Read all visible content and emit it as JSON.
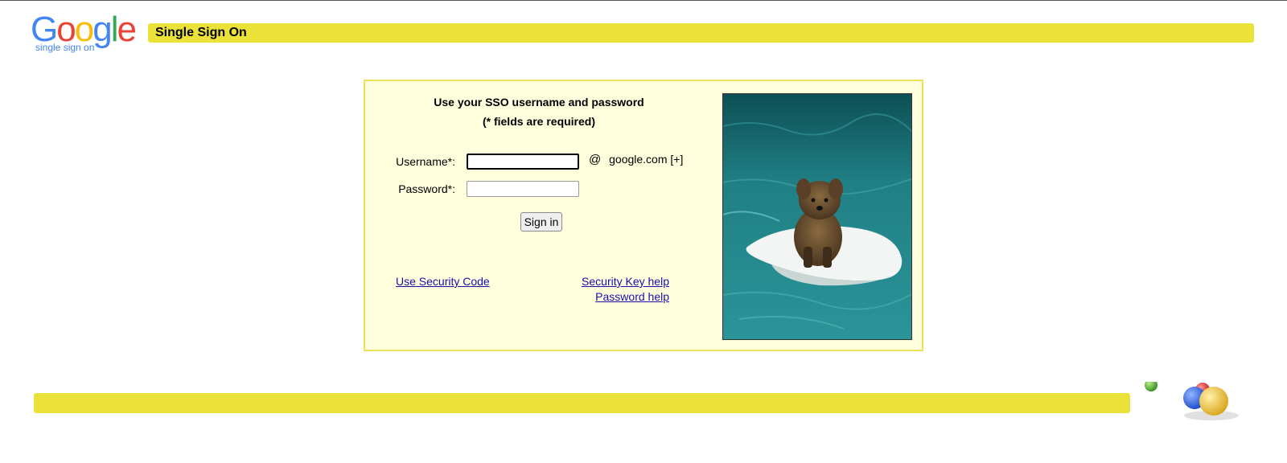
{
  "header": {
    "logo": {
      "wordmark": "Google",
      "subtitle": "single sign on"
    },
    "title": "Single Sign On"
  },
  "login": {
    "heading": "Use your SSO username and password",
    "required_note": "(* fields are required)",
    "username_label": "Username*:",
    "username_value": "",
    "password_label": "Password*:",
    "password_value": "",
    "at_symbol": "@",
    "domain": "google.com",
    "domain_toggle": "[+]",
    "signin_label": "Sign in",
    "links": {
      "security_code": "Use Security Code",
      "security_key_help": "Security Key help",
      "password_help": "Password help"
    }
  },
  "colors": {
    "bar_yellow": "#ebe239",
    "panel_background": "#ffffdd",
    "panel_border": "#eadf56",
    "link": "#1a0dab",
    "google_blue": "#4285f4",
    "google_red": "#ea4335",
    "google_yellow": "#fbbc05",
    "google_green": "#34a853"
  },
  "icons": {
    "photo": "dog-on-surfboard-photo",
    "decoration": "colored-balls-icon"
  }
}
